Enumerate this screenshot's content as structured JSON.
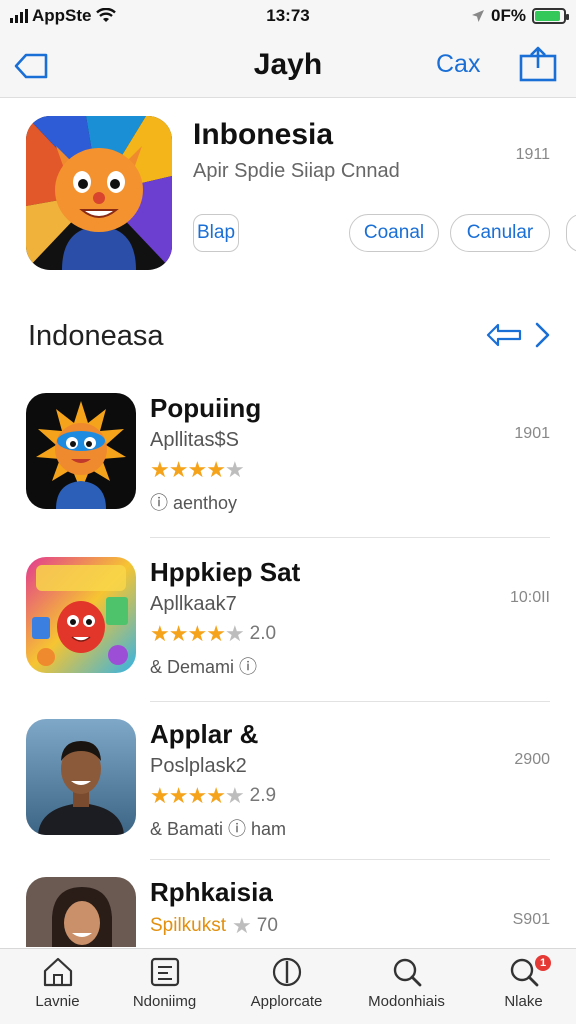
{
  "status": {
    "carrier": "AppSte",
    "time": "13:73",
    "battery_text": "0F%",
    "battery_level": 0.9,
    "battery_color": "#34c759"
  },
  "nav": {
    "title": "Jayh",
    "action_label": "Cax"
  },
  "featured": {
    "title": "Inbonesia",
    "subtitle": "Apir Spdie Siiap Cnnad",
    "meta": "1911",
    "buttons": [
      "Blap",
      "Coanal",
      "Canular"
    ]
  },
  "section": {
    "title": "Indoneasa"
  },
  "apps": [
    {
      "name": "Popuiing",
      "subtitle": "Apllitas$S",
      "meta": "1901",
      "stars": 4,
      "rating": "",
      "extra": "ⓘ aenthoy"
    },
    {
      "name": "Hppkiep Sat",
      "subtitle": "Apllkaak7",
      "meta": "10:0II",
      "stars": 4,
      "rating": "2.0",
      "extra": "& Demami ⓘ"
    },
    {
      "name": "Applar &",
      "subtitle": "Poslplask2",
      "meta": "2900",
      "stars": 4,
      "rating": "2.9",
      "extra": "& Bamati ⓘ ham"
    },
    {
      "name": "Rphkaisia",
      "subtitle": "Spilkukst",
      "meta": "S901",
      "stars": 0,
      "rating": "70",
      "extra": ""
    }
  ],
  "tabs": [
    {
      "label": "Lavnie",
      "icon": "home-icon"
    },
    {
      "label": "Ndoniimg",
      "icon": "document-icon"
    },
    {
      "label": "Applorcate",
      "icon": "compass-icon"
    },
    {
      "label": "Modonhiais",
      "icon": "search-icon"
    },
    {
      "label": "Nlake",
      "icon": "search-badge-icon",
      "badge": "1"
    }
  ],
  "colors": {
    "accent": "#1a6fd6",
    "star": "#f5a31a",
    "badge": "#e53935"
  }
}
